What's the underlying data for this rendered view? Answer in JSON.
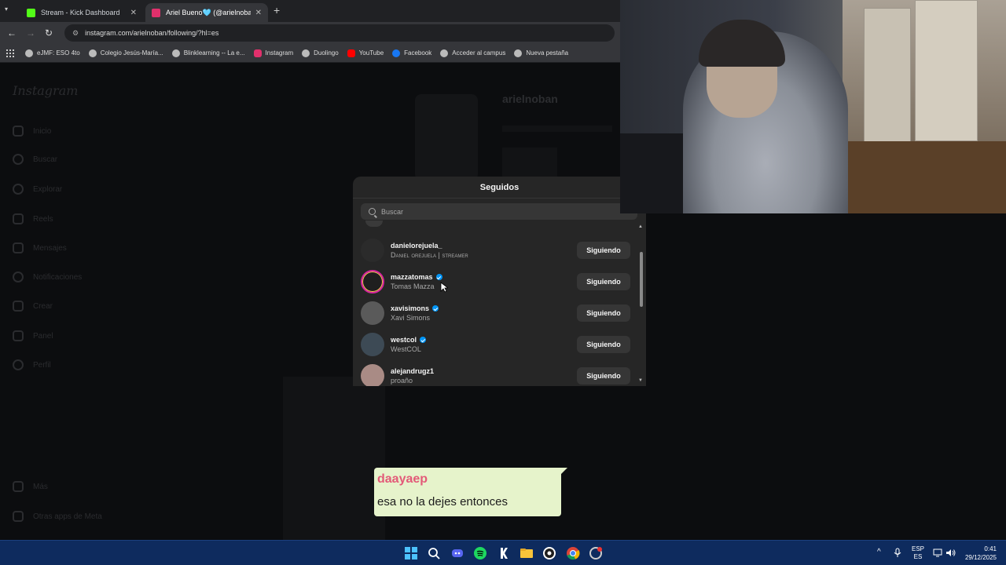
{
  "browser": {
    "tabs": [
      {
        "label": "Stream - Kick Dashboard",
        "color": "#53fc18"
      },
      {
        "label": "Ariel Bueno🩵 (@arielnoban) •",
        "color": "#e1306c"
      }
    ],
    "url": "instagram.com/arielnoban/following/?hl=es",
    "bookmarks": [
      {
        "label": "eJMF: ESO 4to",
        "color": "#bbbbbb"
      },
      {
        "label": "Colegio Jesús-María...",
        "color": "#bbbbbb"
      },
      {
        "label": "Blinklearning -- La e...",
        "color": "#bbbbbb"
      },
      {
        "label": "Instagram",
        "color": "#e1306c"
      },
      {
        "label": "Duolingo",
        "color": "#bbbbbb"
      },
      {
        "label": "YouTube",
        "color": "#ff0000"
      },
      {
        "label": "Facebook",
        "color": "#1877f2"
      },
      {
        "label": "Acceder al campus",
        "color": "#bbbbbb"
      },
      {
        "label": "Nueva pestaña",
        "color": "#bbbbbb"
      }
    ]
  },
  "instagram": {
    "logo": "Instagram",
    "sidebar": [
      "Inicio",
      "Buscar",
      "Explorar",
      "Reels",
      "Mensajes",
      "Notificaciones",
      "Crear",
      "Panel",
      "Perfil",
      "Más",
      "Otras apps de Meta"
    ],
    "profile_username": "arielnoban"
  },
  "modal": {
    "title": "Seguidos",
    "search_placeholder": "Buscar",
    "rows": [
      {
        "username": "danielorejuela_",
        "fullname": "Daniel orejuela | streamer",
        "verified": false,
        "button": "Siguiendo"
      },
      {
        "username": "mazzatomas",
        "fullname": "Tomas Mazza",
        "verified": true,
        "button": "Siguiendo"
      },
      {
        "username": "xavisimons",
        "fullname": "Xavi Simons",
        "verified": true,
        "button": "Siguiendo"
      },
      {
        "username": "westcol",
        "fullname": "WestCOL",
        "verified": true,
        "button": "Siguiendo"
      },
      {
        "username": "alejandrugz1",
        "fullname": "proaño",
        "verified": false,
        "button": "Siguiendo"
      }
    ]
  },
  "chat": {
    "user": "daayaep",
    "message": "esa no la dejes entonces"
  },
  "taskbar": {
    "lang_top": "ESP",
    "lang_bottom": "ES",
    "time": "0:41",
    "date": "29/12/2025"
  }
}
